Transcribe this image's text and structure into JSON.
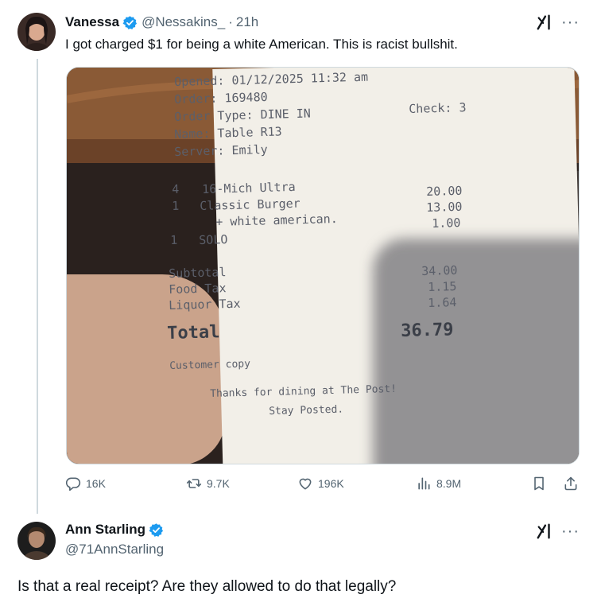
{
  "post": {
    "author_name": "Vanessa",
    "author_handle": "@Nessakins_",
    "separator": "·",
    "time": "21h",
    "text": "I got charged $1 for being a white American. This is racist bullshit.",
    "more_label": "···"
  },
  "receipt": {
    "opened": "Opened: 01/12/2025 11:32 am",
    "order": "Order: 169480",
    "check": "Check: 3",
    "order_type": "Order Type: DINE IN",
    "name": "Name: Table R13",
    "server": "Server: Emily",
    "items": [
      {
        "qty": "4",
        "desc": "16-Mich Ultra",
        "price": "20.00"
      },
      {
        "qty": "1",
        "desc": "Classic Burger",
        "price": "13.00"
      },
      {
        "qty": "",
        "desc": "+ white american.",
        "price": "1.00"
      },
      {
        "qty": "1",
        "desc": "SOLO",
        "price": ""
      }
    ],
    "subtotal_label": "Subtotal",
    "subtotal": "34.00",
    "food_tax_label": "Food Tax",
    "food_tax": "1.15",
    "liquor_tax_label": "Liquor Tax",
    "liquor_tax": "1.64",
    "total_label": "Total",
    "total": "36.79",
    "copy": "Customer copy",
    "thanks": "Thanks for dining at The Post!",
    "stay": "Stay Posted."
  },
  "actions": {
    "replies": "16K",
    "reposts": "9.7K",
    "likes": "196K",
    "views": "8.9M"
  },
  "reply": {
    "author_name": "Ann Starling",
    "author_handle": "@71AnnStarling",
    "text": "Is that a real receipt? Are they allowed to do that legally?",
    "more_label": "···"
  },
  "colors": {
    "verified": "#1d9bf0",
    "muted": "#536471",
    "text": "#0f1419",
    "thread_line": "#cfd9de"
  }
}
